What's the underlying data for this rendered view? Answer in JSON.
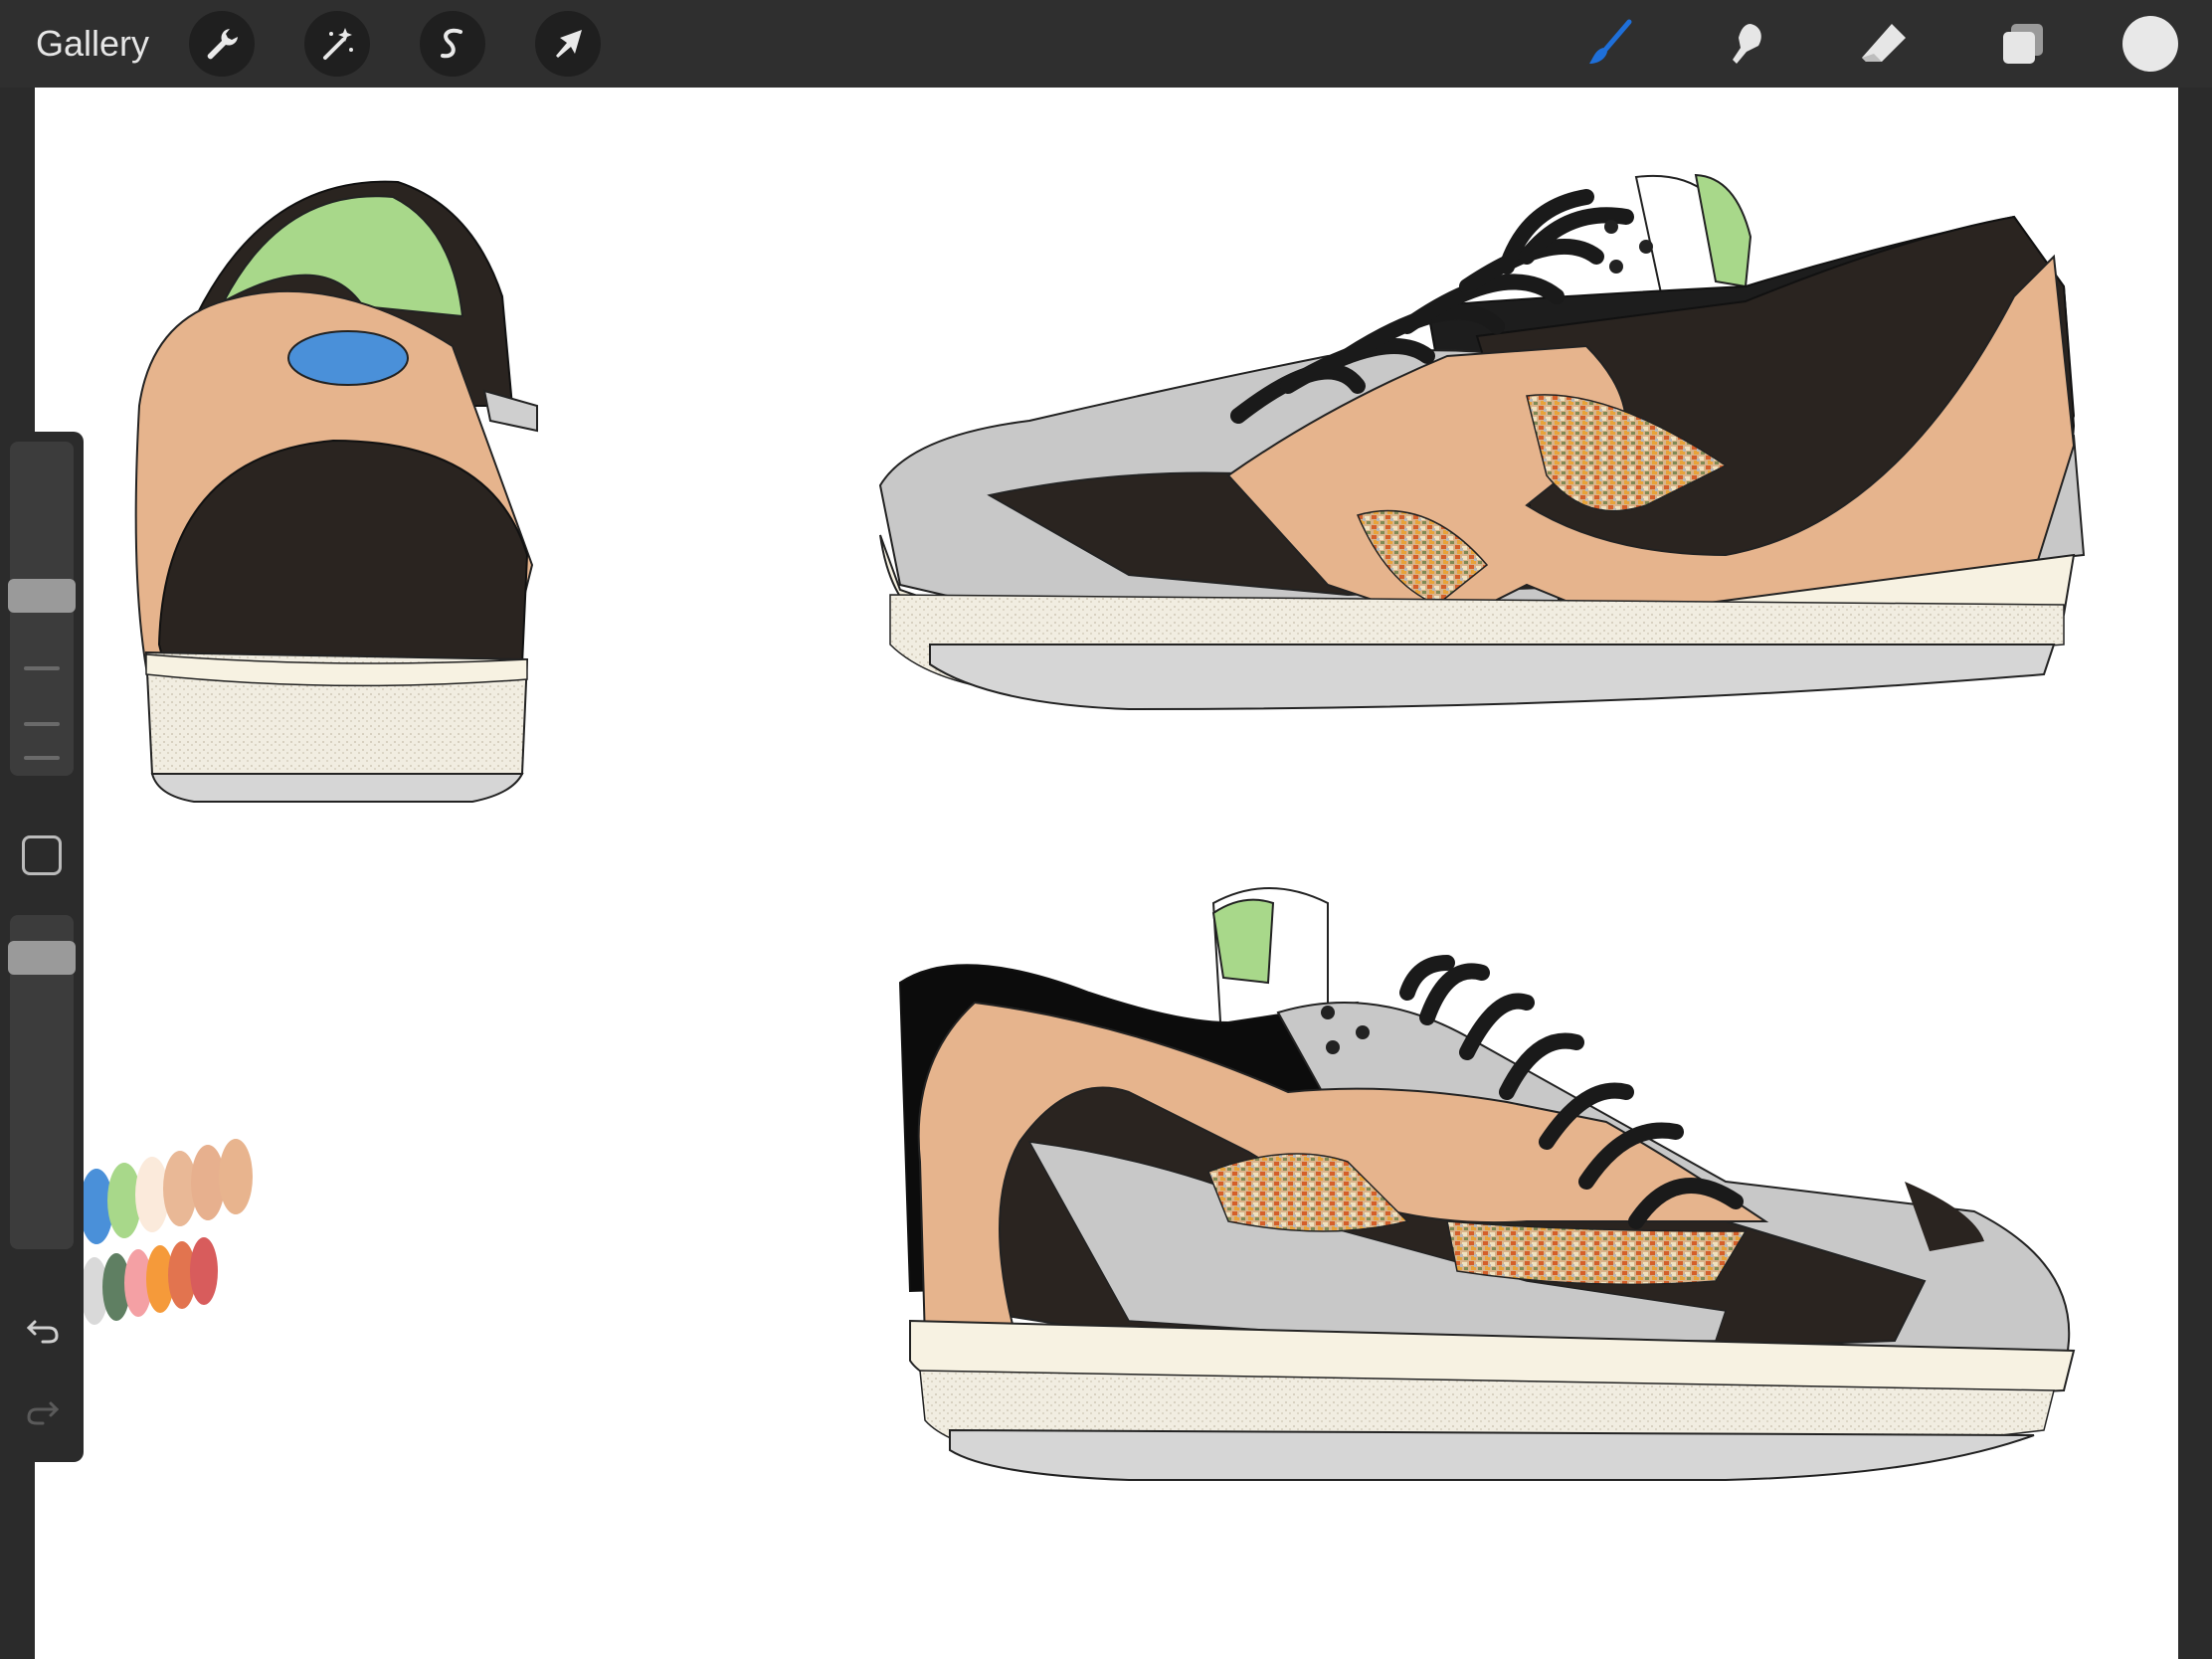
{
  "toolbar": {
    "gallery_label": "Gallery",
    "left_tools": [
      "wrench-icon",
      "magic-wand-icon",
      "selection-s-icon",
      "transform-arrow-icon"
    ],
    "right_tools": [
      "brush-icon",
      "smudge-icon",
      "eraser-icon",
      "layers-icon"
    ],
    "active_tool": "brush-icon",
    "accent_color": "#1e6fd9",
    "current_color": "#e8e8e8"
  },
  "sidebar": {
    "brush_size_level": 0.45,
    "opacity_level": 0.9,
    "buttons": [
      "modify-icon",
      "undo-icon",
      "redo-icon"
    ]
  },
  "canvas": {
    "background": "#ffffff",
    "palette_swatches": [
      "#4a90d9",
      "#a8d88a",
      "#fbeadb",
      "#e9b896",
      "#e7b08e",
      "#e8b48e",
      "#d9d9d9",
      "#5f7f62",
      "#f4a0a4",
      "#f59a3a",
      "#e2744f",
      "#d85c5c"
    ],
    "shoe_colors": {
      "upper_dark": "#2a2420",
      "overlay_tan": "#e6b48d",
      "toe_grey": "#c8c8c8",
      "collar_green": "#a8d88a",
      "heel_logo_blue": "#4a90d9",
      "midsole": "#f7f2e2",
      "outsole_grey": "#d6d6d6"
    }
  }
}
